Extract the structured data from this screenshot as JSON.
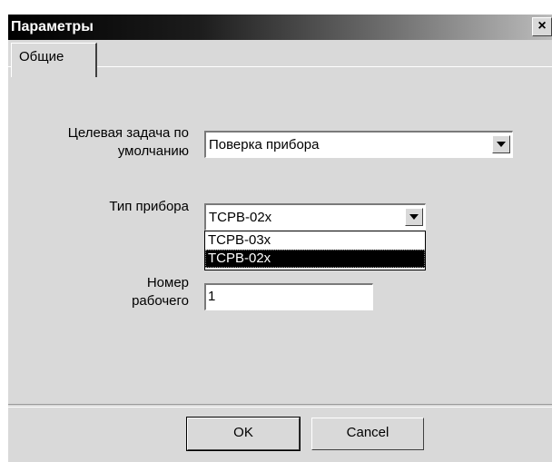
{
  "window": {
    "title": "Параметры",
    "close_label": "×"
  },
  "tabs": [
    {
      "label": "Общие",
      "active": true
    }
  ],
  "form": {
    "target_task": {
      "label_line1": "Целевая задача по",
      "label_line2": "умолчанию",
      "value": "Поверка прибора"
    },
    "device_type": {
      "label": "Тип прибора",
      "value": "ТСРВ-02х",
      "options": [
        "ТСРВ-03х",
        "ТСРВ-02х"
      ],
      "highlighted_option": "ТСРВ-02х"
    },
    "worker_number": {
      "label_line1": "Номер",
      "label_line2": "рабочего",
      "value": "1"
    }
  },
  "buttons": {
    "ok": "OK",
    "cancel": "Cancel"
  },
  "colors": {
    "window_bg": "#d9d9d9",
    "title_text": "#ffffff",
    "selection_bg": "#000000"
  }
}
